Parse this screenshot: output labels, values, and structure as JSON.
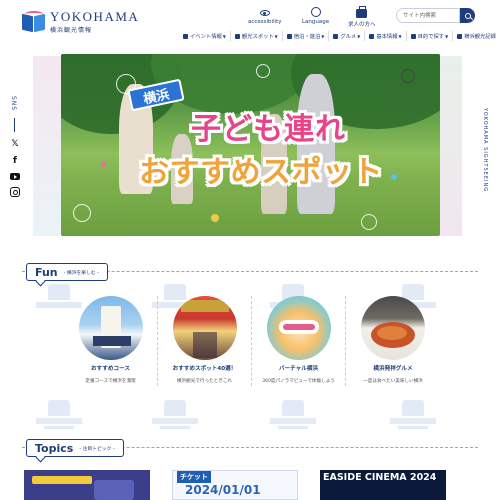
{
  "header": {
    "logo_en": "YOKOHAMA",
    "logo_ja": "横浜観光情報",
    "accessibility": "accessibility",
    "language": "Language",
    "jobs": "求人の方へ",
    "search_placeholder": "サイト内検索"
  },
  "nav": [
    {
      "label": "イベント情報",
      "caret": "▼"
    },
    {
      "label": "観光スポット",
      "caret": "▼"
    },
    {
      "label": "宿泊・遊泊",
      "caret": "▼"
    },
    {
      "label": "グルメ",
      "caret": "▼"
    },
    {
      "label": "基本情報",
      "caret": "▼"
    },
    {
      "label": "目的で探す",
      "caret": "▼"
    },
    {
      "label": "横浜観光記録",
      "caret": ""
    }
  ],
  "hero": {
    "badge": "横浜",
    "title_line1": "子ども連れ",
    "title_line2": "おすすめスポット"
  },
  "side": {
    "sns_label": "SNS",
    "right_text": "YOKOHAMA SIGHTSEEING"
  },
  "fun": {
    "title": "Fun",
    "subtitle": "- 横浜を楽しむ -",
    "cards": [
      {
        "title": "おすすめコース",
        "sub": "定番コースで横浜を満喫"
      },
      {
        "title": "おすすめスポット40選！",
        "sub": "横浜観光で行ったときこれ"
      },
      {
        "title": "バーチャル横浜",
        "sub": "360度パノラマビューで体験しよう"
      },
      {
        "title": "横浜発祥グルメ",
        "sub": "一度は食べたい美味しい横浜"
      }
    ]
  },
  "topics": {
    "title": "Topics",
    "subtitle": "- 注目トピック -",
    "banners": [
      "チケット",
      "2024/01/01",
      "EASIDE CINEMA 2024"
    ]
  },
  "colors": {
    "brand": "#1e3d7a",
    "pink": "#e74587",
    "orange": "#f0a33a"
  }
}
